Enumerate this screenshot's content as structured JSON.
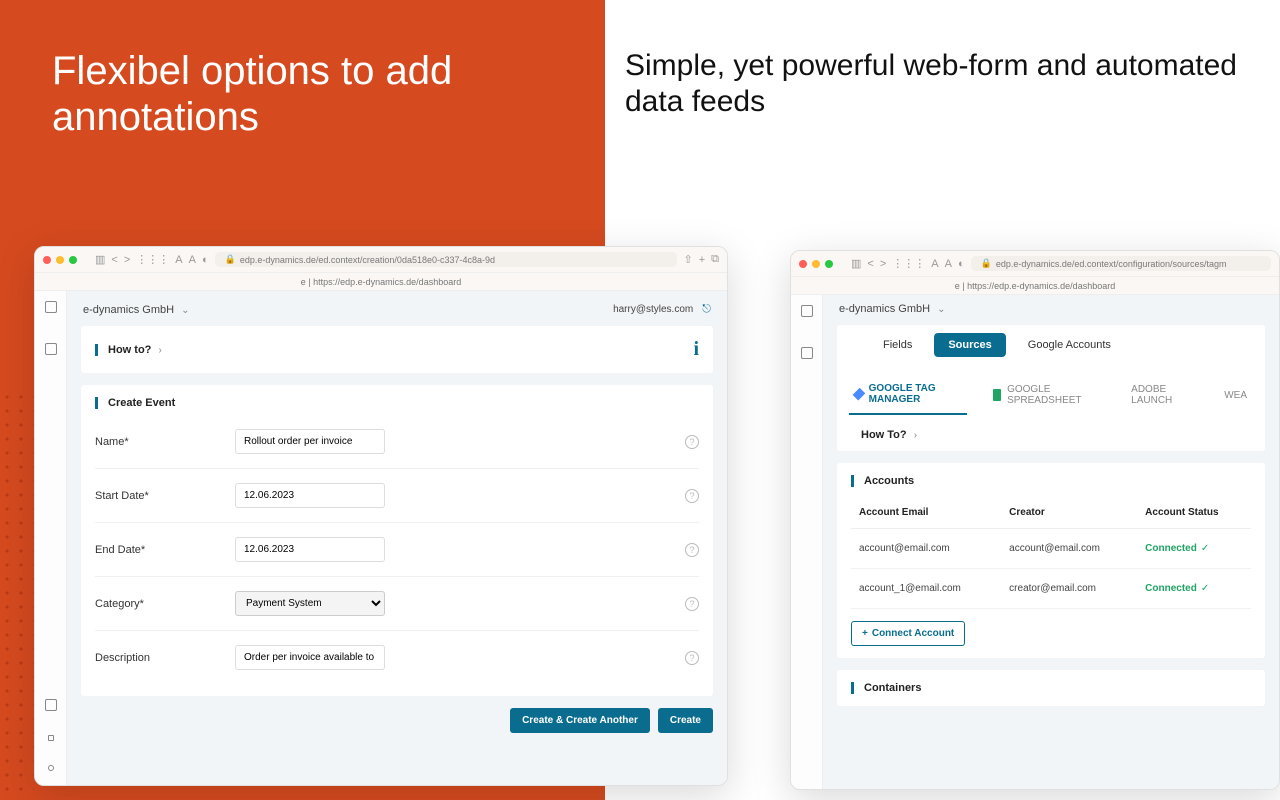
{
  "slide": {
    "left_heading": "Flexibel options to add annotations",
    "right_heading": "Simple, yet powerful web-form and automated data feeds"
  },
  "browser_left": {
    "url": "edp.e-dynamics.de/ed.context/creation/0da518e0-c337-4c8a-9d",
    "tab_title": "e | https://edp.e-dynamics.de/dashboard",
    "org": "e-dynamics GmbH",
    "user_email": "harry@styles.com",
    "howto_label": "How to?",
    "create_event_title": "Create Event",
    "fields": {
      "name_label": "Name*",
      "name_value": "Rollout order per invoice",
      "start_label": "Start Date*",
      "start_value": "12.06.2023",
      "end_label": "End Date*",
      "end_value": "12.06.2023",
      "category_label": "Category*",
      "category_value": "Payment System",
      "description_label": "Description",
      "description_value": "Order per invoice available to all users"
    },
    "buttons": {
      "create_another": "Create & Create Another",
      "create": "Create"
    }
  },
  "browser_right": {
    "url": "edp.e-dynamics.de/ed.context/configuration/sources/tagm",
    "tab_title": "e | https://edp.e-dynamics.de/dashboard",
    "org": "e-dynamics GmbH",
    "tabs": {
      "fields": "Fields",
      "sources": "Sources",
      "google_accounts": "Google Accounts"
    },
    "subtabs": {
      "gtm": "GOOGLE TAG MANAGER",
      "gsheet": "GOOGLE SPREADSHEET",
      "adobe": "ADOBE LAUNCH",
      "wea": "WEA"
    },
    "howto_label": "How To?",
    "accounts_title": "Accounts",
    "table_headers": {
      "email": "Account Email",
      "creator": "Creator",
      "status": "Account Status"
    },
    "table_rows": [
      {
        "email": "account@email.com",
        "creator": "account@email.com",
        "status": "Connected"
      },
      {
        "email": "account_1@email.com",
        "creator": "creator@email.com",
        "status": "Connected"
      }
    ],
    "connect_account": "Connect Account",
    "containers_title": "Containers"
  }
}
